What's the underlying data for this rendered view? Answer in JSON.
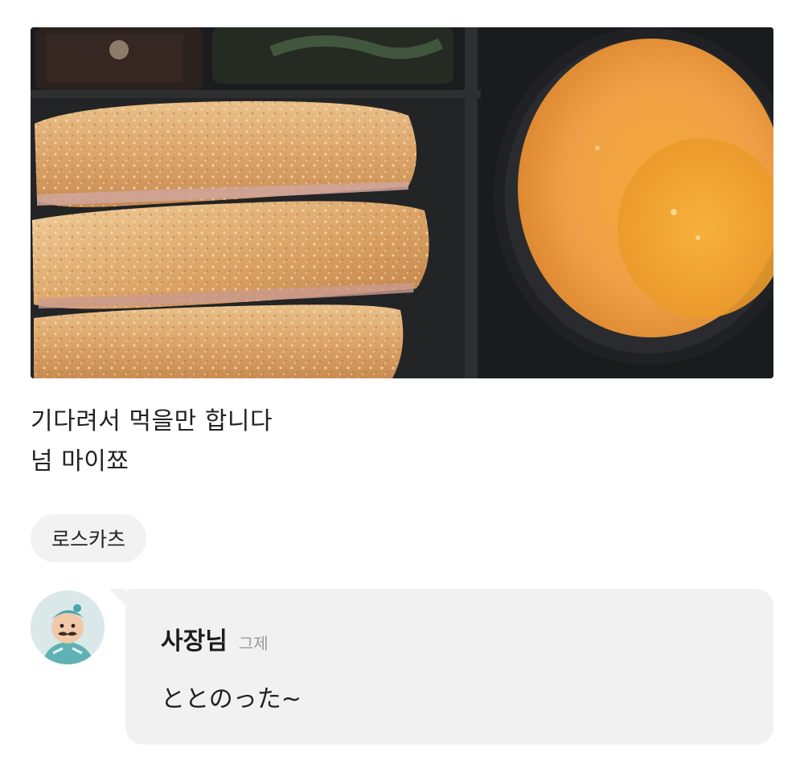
{
  "review": {
    "photo_icon": "food-photo",
    "line1": "기다려서 먹을만 합니다",
    "line2": "넘 마이쬬"
  },
  "menu_tag": {
    "label": "로스카츠"
  },
  "owner_reply": {
    "avatar_icon": "owner-avatar",
    "author": "사장님",
    "time": "그제",
    "text": "ととのった~"
  },
  "colors": {
    "bubble_bg": "#f1f1f1",
    "tag_bg": "#f2f2f2",
    "muted_text": "#9a9a9a"
  }
}
